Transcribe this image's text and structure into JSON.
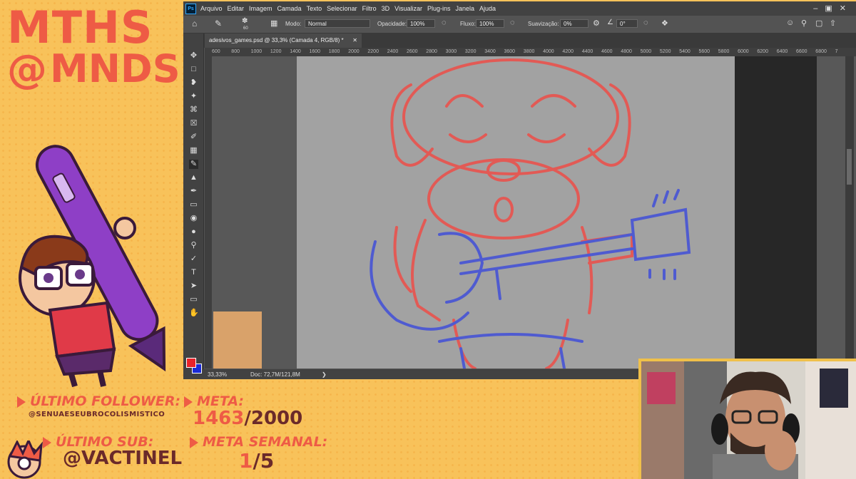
{
  "overlay": {
    "handle_line1": "MTHS",
    "handle_line2": "MNDS",
    "handle_at": "@",
    "last_follower_label": "ÚLTIMO FOLLOWER:",
    "last_follower_value": "@SENUAESEUBROCOLISMISTICO",
    "last_sub_label": "ÚLTIMO SUB:",
    "last_sub_value": "@VACTINEL",
    "goal_label": "META:",
    "goal_current": "1463",
    "goal_total": "/2000",
    "weekly_goal_label": "META SEMANAL:",
    "weekly_goal_current": "1",
    "weekly_goal_total": "/5",
    "accent_color": "#ee5b45",
    "background_color": "#f8c25a"
  },
  "photoshop": {
    "app_icon": "Ps",
    "menu": [
      "Arquivo",
      "Editar",
      "Imagem",
      "Camada",
      "Texto",
      "Selecionar",
      "Filtro",
      "3D",
      "Visualizar",
      "Plug-ins",
      "Janela",
      "Ajuda"
    ],
    "options": {
      "brush_size": "60",
      "mode_label": "Modo:",
      "mode_value": "Normal",
      "opacity_label": "Opacidade:",
      "opacity_value": "100%",
      "flow_label": "Fluxo:",
      "flow_value": "100%",
      "smoothing_label": "Suavização:",
      "smoothing_value": "0%",
      "angle_value": "0°"
    },
    "document_tab": "adesivos_games.psd @ 33,3% (Camada 4, RGB/8) *",
    "ruler_ticks": [
      "600",
      "800",
      "1000",
      "1200",
      "1400",
      "1600",
      "1800",
      "2000",
      "2200",
      "2400",
      "2600",
      "2800",
      "3000",
      "3200",
      "3400",
      "3600",
      "3800",
      "4000",
      "4200",
      "4400",
      "4600",
      "4800",
      "5000",
      "5200",
      "5400",
      "5600",
      "5800",
      "6000",
      "6200",
      "6400",
      "6600",
      "6800",
      "7"
    ],
    "status_zoom": "33,33%",
    "status_doc": "Doc: 72,7M/121,8M",
    "colors": {
      "foreground": "#e8232a",
      "background": "#1a2bd6",
      "sketch_red": "#e25a55",
      "sketch_blue": "#4f5bd0"
    }
  }
}
